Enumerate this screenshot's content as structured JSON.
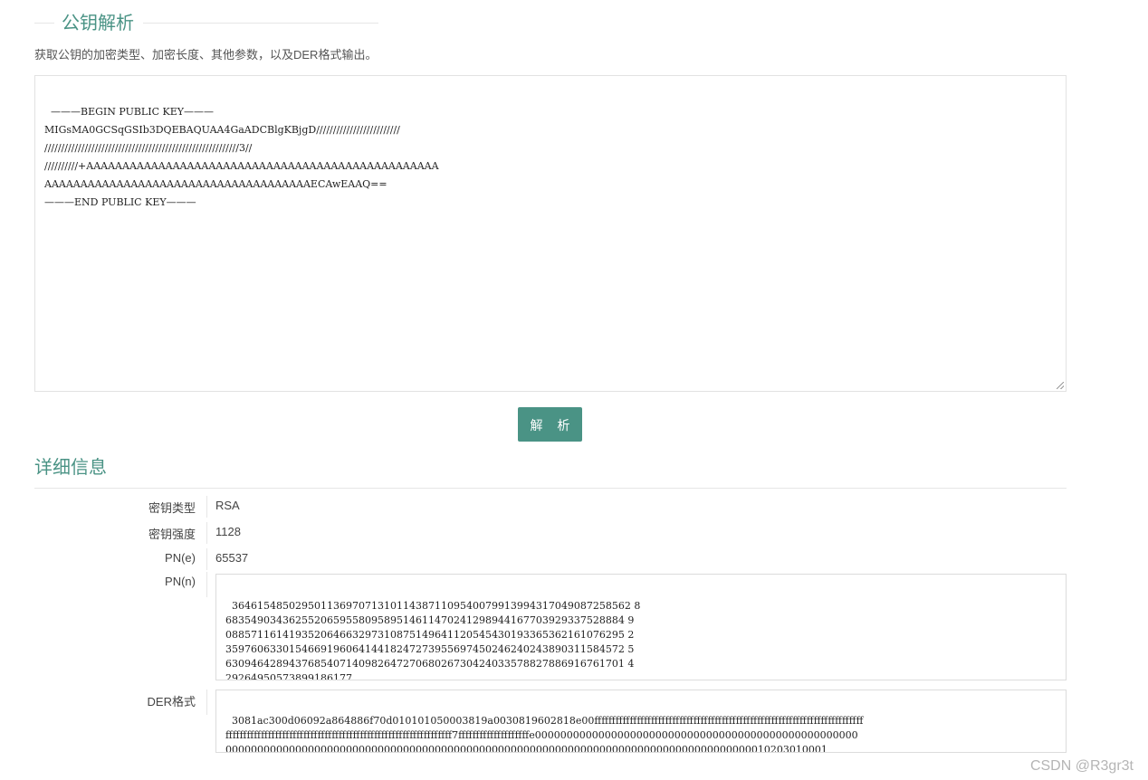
{
  "header": {
    "title": "公钥解析",
    "description": "获取公钥的加密类型、加密长度、其他参数，以及DER格式输出。"
  },
  "key_input": {
    "value": "———BEGIN PUBLIC KEY———\nMIGsMA0GCSqGSIb3DQEBAQUAA4GaADCBlgKBjgD/////////////////////////\n//////////////////////////////////////////////////////////3//\n//////////+AAAAAAAAAAAAAAAAAAAAAAAAAAAAAAAAAAAAAAAAAAAAAAAAA\nAAAAAAAAAAAAAAAAAAAAAAAAAAAAAAAAAAAAAECAwEAAQ==\n———END PUBLIC KEY———"
  },
  "parse_button": {
    "label": "解 析"
  },
  "details": {
    "title": "详细信息",
    "key_type": {
      "label": "密钥类型",
      "value": "RSA"
    },
    "key_strength": {
      "label": "密钥强度",
      "value": "1128"
    },
    "pn_e": {
      "label": "PN(e)",
      "value": "65537"
    },
    "pn_n": {
      "label": "PN(n)",
      "value": "364615485029501136970713101143871109540079913994317049087258562 8\n683549034362552065955809589514611470241298944167703929337528884 9\n088571161419352064663297310875149641120545430193365362161076295 2\n359760633015466919606414418247273955697450246240243890311584572 5\n630946428943768540714098264727068026730424033578827886916761701 4\n29264950573899186177"
    },
    "der": {
      "label": "DER格式",
      "value": "3081ac300d06092a864886f70d010101050003819a0030819602818e00ffffffffffffffffffffffffffffffffffffffffffffffffffffffffffffffffffffffffffff\nffffffffffffffffffffffffffffffffffffffffffffffffffffffffffffffff7ffffffffffffffffffffe000000000000000000000000000000000000000000000000000\n00000000000000000000000000000000000000000000000000000000000000000000000000000000000010203010001"
    }
  },
  "watermark": "CSDN @R3gr3t",
  "colors": {
    "accent": "#4a9385"
  }
}
